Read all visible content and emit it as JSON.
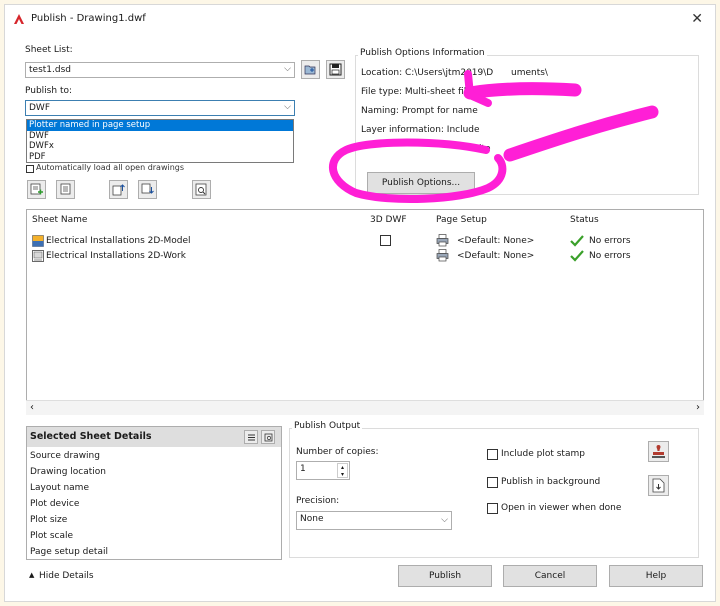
{
  "window": {
    "title": "Publish - Drawing1.dwf",
    "close_glyph": "✕"
  },
  "sheet_list": {
    "label": "Sheet List:",
    "value": "test1.dsd"
  },
  "publish_to": {
    "label": "Publish to:",
    "value": "DWF",
    "options": [
      "Plotter named in page setup",
      "DWF",
      "DWFx",
      "PDF"
    ],
    "partial_checkbox_label": "Automatically load all open drawings"
  },
  "publish_options_info": {
    "title": "Publish Options Information",
    "location": "Location: C:\\Users\\jtm2019\\D",
    "location_tail": "uments\\",
    "file_type": "File type: Multi-sheet file",
    "naming": "Naming: Prompt for name",
    "layer_info": "Layer information: Include",
    "partial_text": "ite",
    "button_label": "Publish Options..."
  },
  "sheet_table": {
    "headers": [
      "Sheet Name",
      "3D DWF",
      "Page Setup",
      "Status"
    ],
    "rows": [
      {
        "name": "Electrical Installations 2D-Model",
        "page_setup": "<Default: None>",
        "status": "No errors",
        "has_3d_checkbox": true
      },
      {
        "name": "Electrical Installations 2D-Work",
        "page_setup": "<Default: None>",
        "status": "No errors",
        "has_3d_checkbox": false
      }
    ]
  },
  "selected_details": {
    "title": "Selected Sheet Details",
    "items": [
      "Source drawing",
      "Drawing location",
      "Layout name",
      "Plot device",
      "Plot size",
      "Plot scale",
      "Page setup detail"
    ]
  },
  "publish_output": {
    "title": "Publish Output",
    "copies_label": "Number of copies:",
    "copies_value": "1",
    "precision_label": "Precision:",
    "precision_value": "None",
    "include_stamp": "Include plot stamp",
    "background": "Publish in background",
    "open_viewer": "Open in viewer when done"
  },
  "footer": {
    "hide_details": "Hide Details",
    "publish": "Publish",
    "cancel": "Cancel",
    "help": "Help"
  },
  "colors": {
    "annotation": "#ff1fd6",
    "accent": "#0078d7",
    "status_ok": "#3aa02a"
  }
}
